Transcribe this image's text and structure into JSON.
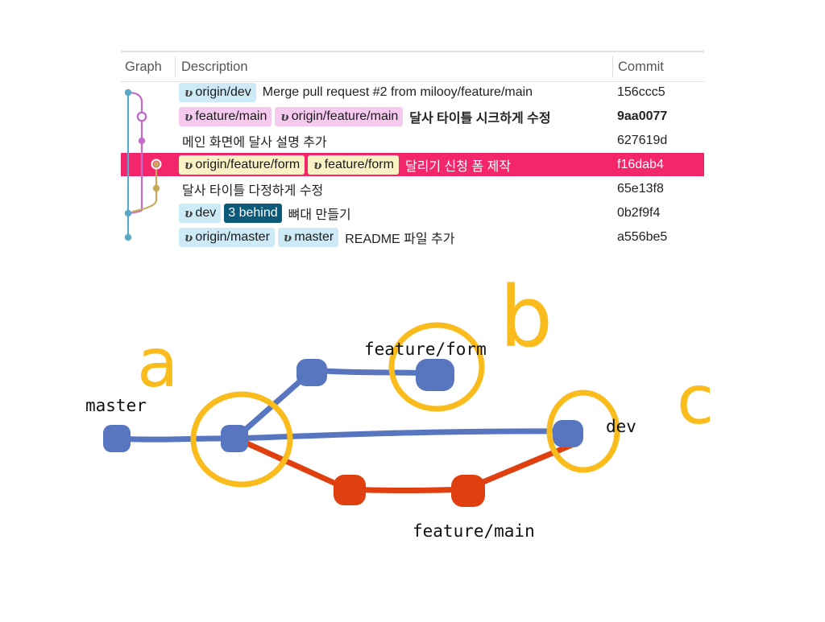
{
  "log": {
    "columns": {
      "graph": "Graph",
      "description": "Description",
      "commit": "Commit"
    },
    "rows": [
      {
        "tags": [
          {
            "label": "origin/dev",
            "color": "blue"
          }
        ],
        "message": "Merge pull request #2 from milooy/feature/main",
        "commit": "156ccc5",
        "selected": false,
        "bold": false
      },
      {
        "tags": [
          {
            "label": "feature/main",
            "color": "pink"
          },
          {
            "label": "origin/feature/main",
            "color": "pink"
          }
        ],
        "message": "달사 타이틀 시크하게 수정",
        "commit": "9aa0077",
        "selected": false,
        "bold": true
      },
      {
        "tags": [],
        "message": "메인 화면에 달사 설명 추가",
        "commit": "627619d",
        "selected": false,
        "bold": false
      },
      {
        "tags": [
          {
            "label": "origin/feature/form",
            "color": "yellow"
          },
          {
            "label": "feature/form",
            "color": "yellow"
          }
        ],
        "message": "달리기 신청 폼 제작",
        "commit": "f16dab4",
        "selected": true,
        "bold": false
      },
      {
        "tags": [],
        "message": "달사 타이틀 다정하게 수정",
        "commit": "65e13f8",
        "selected": false,
        "bold": false
      },
      {
        "tags": [
          {
            "label": "dev",
            "color": "blue"
          },
          {
            "label": "3 behind",
            "color": "dark",
            "badge": true
          }
        ],
        "message": "뼈대 만들기",
        "commit": "0b2f9f4",
        "selected": false,
        "bold": false
      },
      {
        "tags": [
          {
            "label": "origin/master",
            "color": "blue"
          },
          {
            "label": "master",
            "color": "blue"
          }
        ],
        "message": "README 파일 추가",
        "commit": "a556be5",
        "selected": false,
        "bold": false
      }
    ],
    "colors": {
      "selected": "#f4266b",
      "lane_blue": "#5aa7c8",
      "lane_pink": "#c56bcc",
      "lane_olive": "#c9a95a"
    }
  },
  "sketch": {
    "labels": {
      "master": "master",
      "feature_form": "feature/form",
      "dev": "dev",
      "feature_main": "feature/main"
    },
    "letters": {
      "a": "a",
      "b": "b",
      "c": "c"
    },
    "colors": {
      "blue": "#5876c0",
      "orange": "#e0400f",
      "yellow": "#f9bc1c"
    }
  }
}
